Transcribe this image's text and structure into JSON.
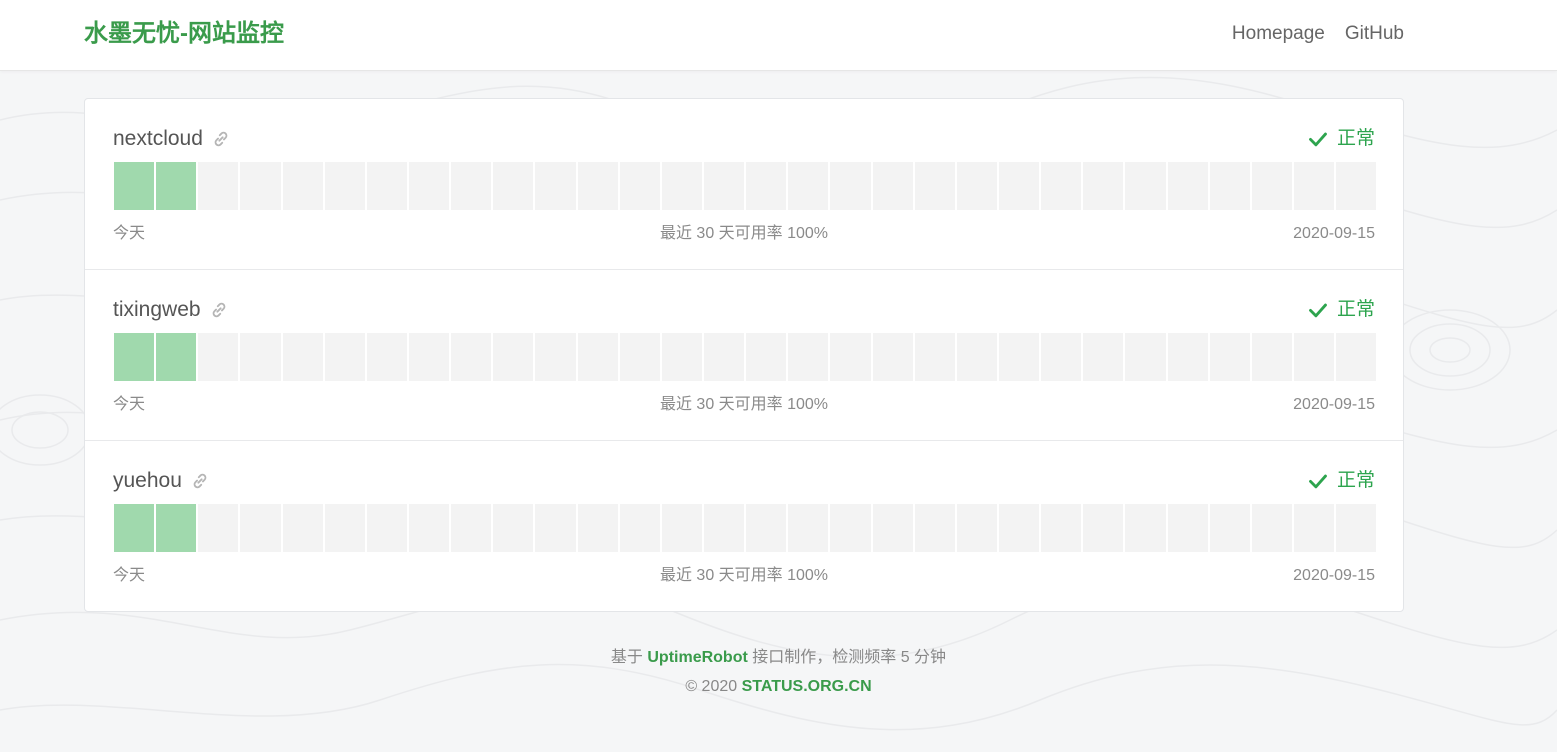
{
  "header": {
    "brand": "水墨无忧-网站监控",
    "nav": [
      {
        "label": "Homepage"
      },
      {
        "label": "GitHub"
      }
    ]
  },
  "monitors": [
    {
      "name": "nextcloud",
      "status": "正常",
      "bars_total": 30,
      "bars_up": 2,
      "left_label": "今天",
      "mid_label": "最近 30 天可用率 100%",
      "right_label": "2020-09-15"
    },
    {
      "name": "tixingweb",
      "status": "正常",
      "bars_total": 30,
      "bars_up": 2,
      "left_label": "今天",
      "mid_label": "最近 30 天可用率 100%",
      "right_label": "2020-09-15"
    },
    {
      "name": "yuehou",
      "status": "正常",
      "bars_total": 30,
      "bars_up": 2,
      "left_label": "今天",
      "mid_label": "最近 30 天可用率 100%",
      "right_label": "2020-09-15"
    }
  ],
  "footer": {
    "line1_prefix": "基于 ",
    "line1_link": "UptimeRobot",
    "line1_suffix": " 接口制作，检测频率 5 分钟",
    "line2_prefix": "© 2020 ",
    "line2_link": "STATUS.ORG.CN"
  },
  "colors": {
    "brand": "#3a9b4b",
    "status_ok": "#2da44e",
    "bar_up": "#a0d9ad",
    "bar_empty": "#f3f3f3"
  },
  "icons": {
    "link": "link-icon",
    "check": "check-icon"
  }
}
